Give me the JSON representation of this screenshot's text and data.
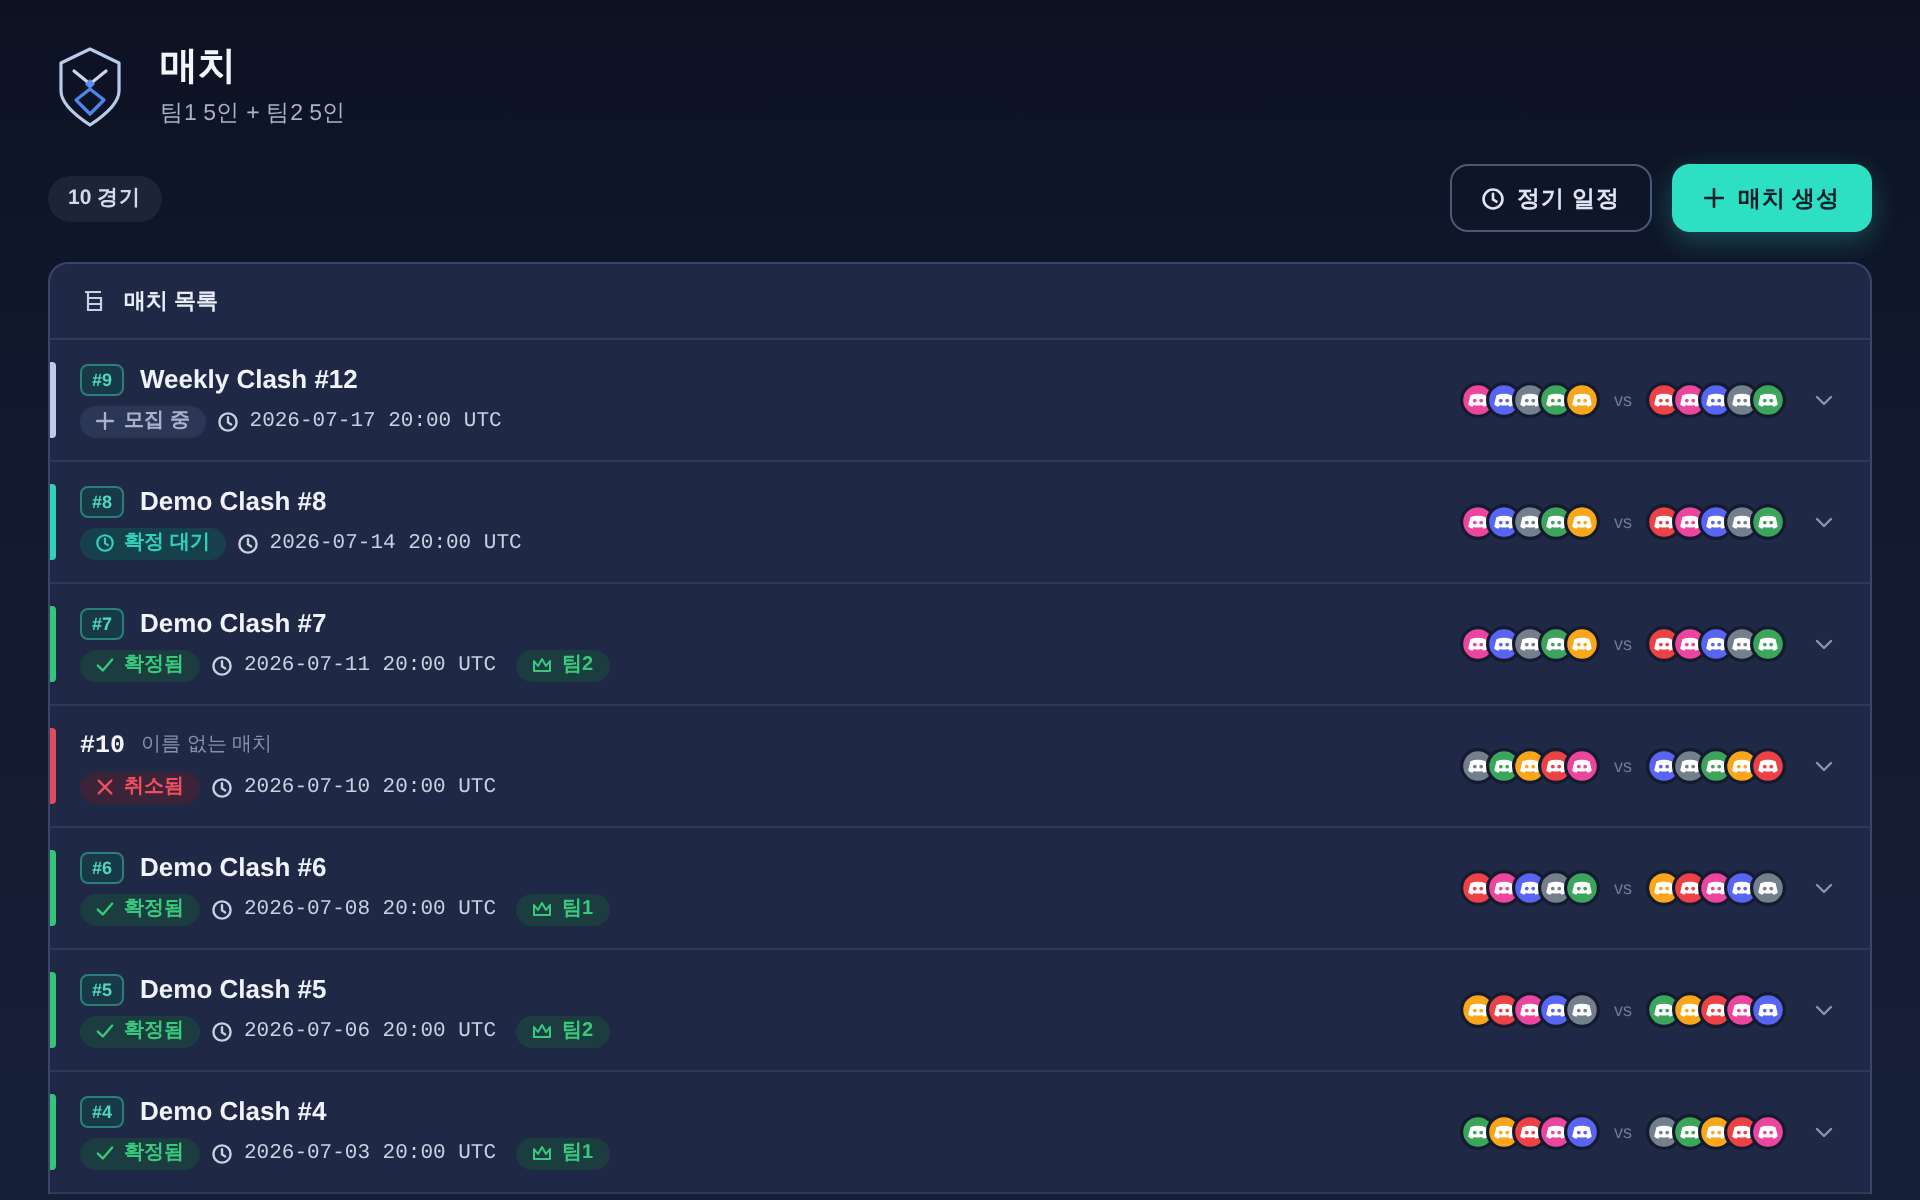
{
  "header": {
    "title": "매치",
    "subtitle": "팀1 5인 + 팀2 5인"
  },
  "count_badge": "10 경기",
  "buttons": [
    {
      "kind": "outline",
      "label": "정기 일정"
    },
    {
      "kind": "primary",
      "label": "매치 생성"
    }
  ],
  "panel": {
    "title": "매치 목록",
    "matches": [
      {
        "kind": "named",
        "number": "#9",
        "title": "Weekly Clash #12",
        "status": {
          "kind": "recruiting",
          "label": "모집 중"
        },
        "time": "2026-07-17 20:00 UTC",
        "team1": [
          {
            "color": "#eb459e"
          },
          {
            "color": "#5865f2"
          },
          {
            "color": "#747f8d"
          },
          {
            "color": "#3ba55c"
          },
          {
            "color": "#faa61a"
          }
        ],
        "versus": "vs",
        "team2": [
          {
            "color": "#ed4245"
          },
          {
            "color": "#eb459e"
          },
          {
            "color": "#5865f2"
          },
          {
            "color": "#747f8d"
          },
          {
            "color": "#3ba55c"
          }
        ],
        "expanded": false
      },
      {
        "kind": "named",
        "number": "#8",
        "title": "Demo Clash #8",
        "status": {
          "kind": "pending",
          "label": "확정 대기"
        },
        "time": "2026-07-14 20:00 UTC",
        "team1": [
          {
            "color": "#eb459e"
          },
          {
            "color": "#5865f2"
          },
          {
            "color": "#747f8d"
          },
          {
            "color": "#3ba55c"
          },
          {
            "color": "#faa61a"
          }
        ],
        "versus": "vs",
        "team2": [
          {
            "color": "#ed4245"
          },
          {
            "color": "#eb459e"
          },
          {
            "color": "#5865f2"
          },
          {
            "color": "#747f8d"
          },
          {
            "color": "#3ba55c"
          }
        ],
        "expanded": false
      },
      {
        "kind": "named",
        "number": "#7",
        "title": "Demo Clash #7",
        "status": {
          "kind": "confirmed",
          "label": "확정됨"
        },
        "time": "2026-07-11 20:00 UTC",
        "winner": "팀2",
        "team1": [
          {
            "color": "#eb459e"
          },
          {
            "color": "#5865f2"
          },
          {
            "color": "#747f8d"
          },
          {
            "color": "#3ba55c"
          },
          {
            "color": "#faa61a"
          }
        ],
        "versus": "vs",
        "team2": [
          {
            "color": "#ed4245"
          },
          {
            "color": "#eb459e"
          },
          {
            "color": "#5865f2"
          },
          {
            "color": "#747f8d"
          },
          {
            "color": "#3ba55c"
          }
        ],
        "expanded": false
      },
      {
        "kind": "unnamed",
        "number": "#10",
        "title": "이름 없는 매치",
        "status": {
          "kind": "cancelled",
          "label": "취소됨"
        },
        "time": "2026-07-10 20:00 UTC",
        "team1": [
          {
            "color": "#747f8d"
          },
          {
            "color": "#3ba55c"
          },
          {
            "color": "#faa61a"
          },
          {
            "color": "#ed4245"
          },
          {
            "color": "#eb459e"
          }
        ],
        "versus": "vs",
        "team2": [
          {
            "color": "#5865f2"
          },
          {
            "color": "#747f8d"
          },
          {
            "color": "#3ba55c"
          },
          {
            "color": "#faa61a"
          },
          {
            "color": "#ed4245"
          }
        ],
        "expanded": false
      },
      {
        "kind": "named",
        "number": "#6",
        "title": "Demo Clash #6",
        "status": {
          "kind": "confirmed",
          "label": "확정됨"
        },
        "time": "2026-07-08 20:00 UTC",
        "winner": "팀1",
        "team1": [
          {
            "color": "#ed4245"
          },
          {
            "color": "#eb459e"
          },
          {
            "color": "#5865f2"
          },
          {
            "color": "#747f8d"
          },
          {
            "color": "#3ba55c"
          }
        ],
        "versus": "vs",
        "team2": [
          {
            "color": "#faa61a"
          },
          {
            "color": "#ed4245"
          },
          {
            "color": "#eb459e"
          },
          {
            "color": "#5865f2"
          },
          {
            "color": "#747f8d"
          }
        ],
        "expanded": false
      },
      {
        "kind": "named",
        "number": "#5",
        "title": "Demo Clash #5",
        "status": {
          "kind": "confirmed",
          "label": "확정됨"
        },
        "time": "2026-07-06 20:00 UTC",
        "winner": "팀2",
        "team1": [
          {
            "color": "#faa61a"
          },
          {
            "color": "#ed4245"
          },
          {
            "color": "#eb459e"
          },
          {
            "color": "#5865f2"
          },
          {
            "color": "#747f8d"
          }
        ],
        "versus": "vs",
        "team2": [
          {
            "color": "#3ba55c"
          },
          {
            "color": "#faa61a"
          },
          {
            "color": "#ed4245"
          },
          {
            "color": "#eb459e"
          },
          {
            "color": "#5865f2"
          }
        ],
        "expanded": false
      },
      {
        "kind": "named",
        "number": "#4",
        "title": "Demo Clash #4",
        "status": {
          "kind": "confirmed",
          "label": "확정됨"
        },
        "time": "2026-07-03 20:00 UTC",
        "winner": "팀1",
        "team1": [
          {
            "color": "#3ba55c"
          },
          {
            "color": "#faa61a"
          },
          {
            "color": "#ed4245"
          },
          {
            "color": "#eb459e"
          },
          {
            "color": "#5865f2"
          }
        ],
        "versus": "vs",
        "team2": [
          {
            "color": "#747f8d"
          },
          {
            "color": "#3ba55c"
          },
          {
            "color": "#faa61a"
          },
          {
            "color": "#ed4245"
          },
          {
            "color": "#eb459e"
          }
        ],
        "expanded": false
      }
    ]
  }
}
